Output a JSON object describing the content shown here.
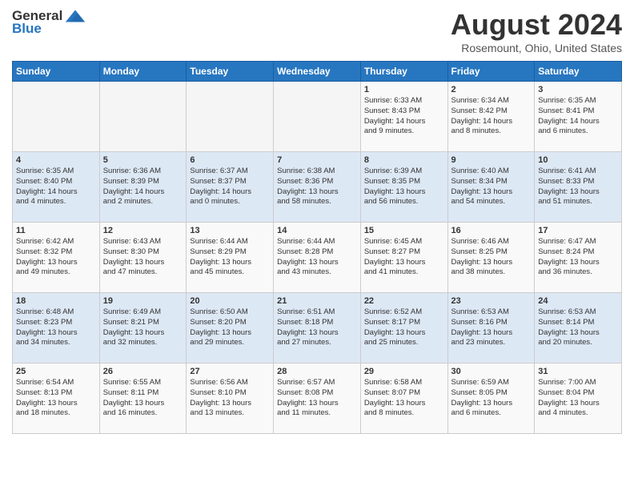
{
  "header": {
    "logo_general": "General",
    "logo_blue": "Blue",
    "month_year": "August 2024",
    "location": "Rosemount, Ohio, United States"
  },
  "weekdays": [
    "Sunday",
    "Monday",
    "Tuesday",
    "Wednesday",
    "Thursday",
    "Friday",
    "Saturday"
  ],
  "weeks": [
    [
      {
        "day": "",
        "info": ""
      },
      {
        "day": "",
        "info": ""
      },
      {
        "day": "",
        "info": ""
      },
      {
        "day": "",
        "info": ""
      },
      {
        "day": "1",
        "info": "Sunrise: 6:33 AM\nSunset: 8:43 PM\nDaylight: 14 hours\nand 9 minutes."
      },
      {
        "day": "2",
        "info": "Sunrise: 6:34 AM\nSunset: 8:42 PM\nDaylight: 14 hours\nand 8 minutes."
      },
      {
        "day": "3",
        "info": "Sunrise: 6:35 AM\nSunset: 8:41 PM\nDaylight: 14 hours\nand 6 minutes."
      }
    ],
    [
      {
        "day": "4",
        "info": "Sunrise: 6:35 AM\nSunset: 8:40 PM\nDaylight: 14 hours\nand 4 minutes."
      },
      {
        "day": "5",
        "info": "Sunrise: 6:36 AM\nSunset: 8:39 PM\nDaylight: 14 hours\nand 2 minutes."
      },
      {
        "day": "6",
        "info": "Sunrise: 6:37 AM\nSunset: 8:37 PM\nDaylight: 14 hours\nand 0 minutes."
      },
      {
        "day": "7",
        "info": "Sunrise: 6:38 AM\nSunset: 8:36 PM\nDaylight: 13 hours\nand 58 minutes."
      },
      {
        "day": "8",
        "info": "Sunrise: 6:39 AM\nSunset: 8:35 PM\nDaylight: 13 hours\nand 56 minutes."
      },
      {
        "day": "9",
        "info": "Sunrise: 6:40 AM\nSunset: 8:34 PM\nDaylight: 13 hours\nand 54 minutes."
      },
      {
        "day": "10",
        "info": "Sunrise: 6:41 AM\nSunset: 8:33 PM\nDaylight: 13 hours\nand 51 minutes."
      }
    ],
    [
      {
        "day": "11",
        "info": "Sunrise: 6:42 AM\nSunset: 8:32 PM\nDaylight: 13 hours\nand 49 minutes."
      },
      {
        "day": "12",
        "info": "Sunrise: 6:43 AM\nSunset: 8:30 PM\nDaylight: 13 hours\nand 47 minutes."
      },
      {
        "day": "13",
        "info": "Sunrise: 6:44 AM\nSunset: 8:29 PM\nDaylight: 13 hours\nand 45 minutes."
      },
      {
        "day": "14",
        "info": "Sunrise: 6:44 AM\nSunset: 8:28 PM\nDaylight: 13 hours\nand 43 minutes."
      },
      {
        "day": "15",
        "info": "Sunrise: 6:45 AM\nSunset: 8:27 PM\nDaylight: 13 hours\nand 41 minutes."
      },
      {
        "day": "16",
        "info": "Sunrise: 6:46 AM\nSunset: 8:25 PM\nDaylight: 13 hours\nand 38 minutes."
      },
      {
        "day": "17",
        "info": "Sunrise: 6:47 AM\nSunset: 8:24 PM\nDaylight: 13 hours\nand 36 minutes."
      }
    ],
    [
      {
        "day": "18",
        "info": "Sunrise: 6:48 AM\nSunset: 8:23 PM\nDaylight: 13 hours\nand 34 minutes."
      },
      {
        "day": "19",
        "info": "Sunrise: 6:49 AM\nSunset: 8:21 PM\nDaylight: 13 hours\nand 32 minutes."
      },
      {
        "day": "20",
        "info": "Sunrise: 6:50 AM\nSunset: 8:20 PM\nDaylight: 13 hours\nand 29 minutes."
      },
      {
        "day": "21",
        "info": "Sunrise: 6:51 AM\nSunset: 8:18 PM\nDaylight: 13 hours\nand 27 minutes."
      },
      {
        "day": "22",
        "info": "Sunrise: 6:52 AM\nSunset: 8:17 PM\nDaylight: 13 hours\nand 25 minutes."
      },
      {
        "day": "23",
        "info": "Sunrise: 6:53 AM\nSunset: 8:16 PM\nDaylight: 13 hours\nand 23 minutes."
      },
      {
        "day": "24",
        "info": "Sunrise: 6:53 AM\nSunset: 8:14 PM\nDaylight: 13 hours\nand 20 minutes."
      }
    ],
    [
      {
        "day": "25",
        "info": "Sunrise: 6:54 AM\nSunset: 8:13 PM\nDaylight: 13 hours\nand 18 minutes."
      },
      {
        "day": "26",
        "info": "Sunrise: 6:55 AM\nSunset: 8:11 PM\nDaylight: 13 hours\nand 16 minutes."
      },
      {
        "day": "27",
        "info": "Sunrise: 6:56 AM\nSunset: 8:10 PM\nDaylight: 13 hours\nand 13 minutes."
      },
      {
        "day": "28",
        "info": "Sunrise: 6:57 AM\nSunset: 8:08 PM\nDaylight: 13 hours\nand 11 minutes."
      },
      {
        "day": "29",
        "info": "Sunrise: 6:58 AM\nSunset: 8:07 PM\nDaylight: 13 hours\nand 8 minutes."
      },
      {
        "day": "30",
        "info": "Sunrise: 6:59 AM\nSunset: 8:05 PM\nDaylight: 13 hours\nand 6 minutes."
      },
      {
        "day": "31",
        "info": "Sunrise: 7:00 AM\nSunset: 8:04 PM\nDaylight: 13 hours\nand 4 minutes."
      }
    ]
  ]
}
